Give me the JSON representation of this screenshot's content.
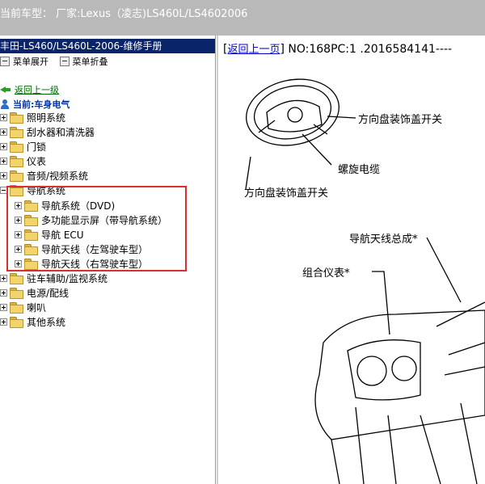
{
  "header": {
    "current_vehicle": "当前车型：  厂家:Lexus（凌志)LS460L/LS4602006"
  },
  "left_pane": {
    "title": "丰田-LS460/LS460L-2006-维修手册",
    "toolbar": {
      "expand_label": "菜单展开",
      "collapse_label": "菜单折叠"
    },
    "back_link": "返回上一级",
    "current_label": "当前:车身电气",
    "tree": [
      {
        "label": "照明系统",
        "expanded": false
      },
      {
        "label": "刮水器和清洗器",
        "expanded": false
      },
      {
        "label": "门锁",
        "expanded": false
      },
      {
        "label": "仪表",
        "expanded": false
      },
      {
        "label": "音频/视频系统",
        "expanded": false
      },
      {
        "label": "导航系统",
        "expanded": true,
        "children": [
          {
            "label": "导航系统（DVD)"
          },
          {
            "label": "多功能显示屏（带导航系统）"
          },
          {
            "label": "导航 ECU"
          },
          {
            "label": "导航天线（左驾驶车型）"
          },
          {
            "label": "导航天线（右驾驶车型）"
          }
        ]
      },
      {
        "label": "驻车辅助/监视系统",
        "expanded": false
      },
      {
        "label": "电源/配线",
        "expanded": false
      },
      {
        "label": "喇叭",
        "expanded": false
      },
      {
        "label": "其他系统",
        "expanded": false
      }
    ]
  },
  "right_pane": {
    "back_link": "返回上一页",
    "doc_id": "NO:168PC:1 .2016584141----",
    "callouts": {
      "steering_cover_switch_1": "方向盘装饰盖开关",
      "spiral_cable": "螺旋电缆",
      "steering_cover_switch_2": "方向盘装饰盖开关",
      "nav_antenna_assy": "导航天线总成*",
      "combination_meter": "组合仪表*"
    }
  },
  "colors": {
    "title_bar": "#0a246a",
    "top_bar": "#b9b9b9",
    "highlight_box": "#d9302e",
    "back_link_green": "#006600"
  }
}
